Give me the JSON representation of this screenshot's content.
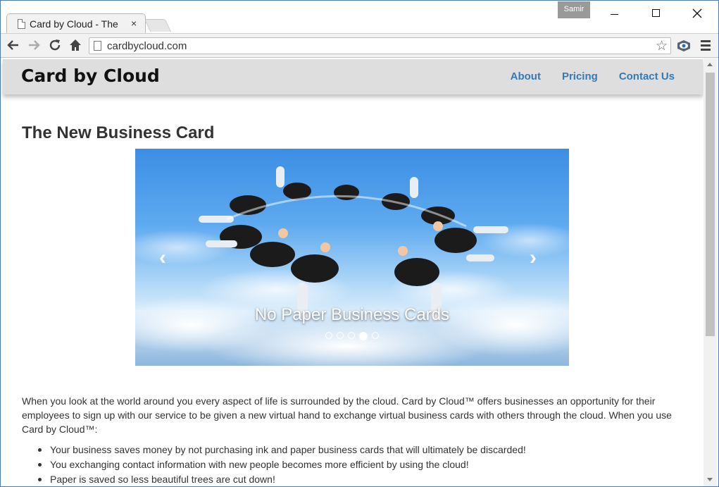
{
  "browser": {
    "tab_title": "Card by Cloud - The",
    "tab_close": "×",
    "profile_name": "Samir",
    "url": "cardbycloud.com"
  },
  "site": {
    "brand": "Card by Cloud",
    "nav": [
      {
        "label": "About"
      },
      {
        "label": "Pricing"
      },
      {
        "label": "Contact Us"
      }
    ],
    "heading": "The New Business Card",
    "carousel": {
      "caption": "No Paper Business Cards",
      "slide_count": 5,
      "active_index": 3
    },
    "intro": "When you look at the world around you every aspect of life is surrounded by the cloud. Card by Cloud™ offers businesses an opportunity for their employees to sign up with our service to be given a new virtual hand to exchange virtual business cards with others through the cloud. When you use Card by Cloud™:",
    "bullets": [
      "Your business saves money by not purchasing ink and paper business cards that will ultimately be discarded!",
      "You exchanging contact information with new people becomes more efficient by using the cloud!",
      "Paper is saved so less beautiful trees are cut down!"
    ]
  },
  "colors": {
    "link": "#337ab7",
    "navbar_bg": "#dedede",
    "window_border": "#4a7bb7"
  },
  "icons": {
    "back": "arrow-left-icon",
    "forward": "arrow-right-icon",
    "reload": "reload-icon",
    "home": "home-icon",
    "bookmark": "star-icon",
    "extension": "eye-icon",
    "menu": "hamburger-icon"
  }
}
